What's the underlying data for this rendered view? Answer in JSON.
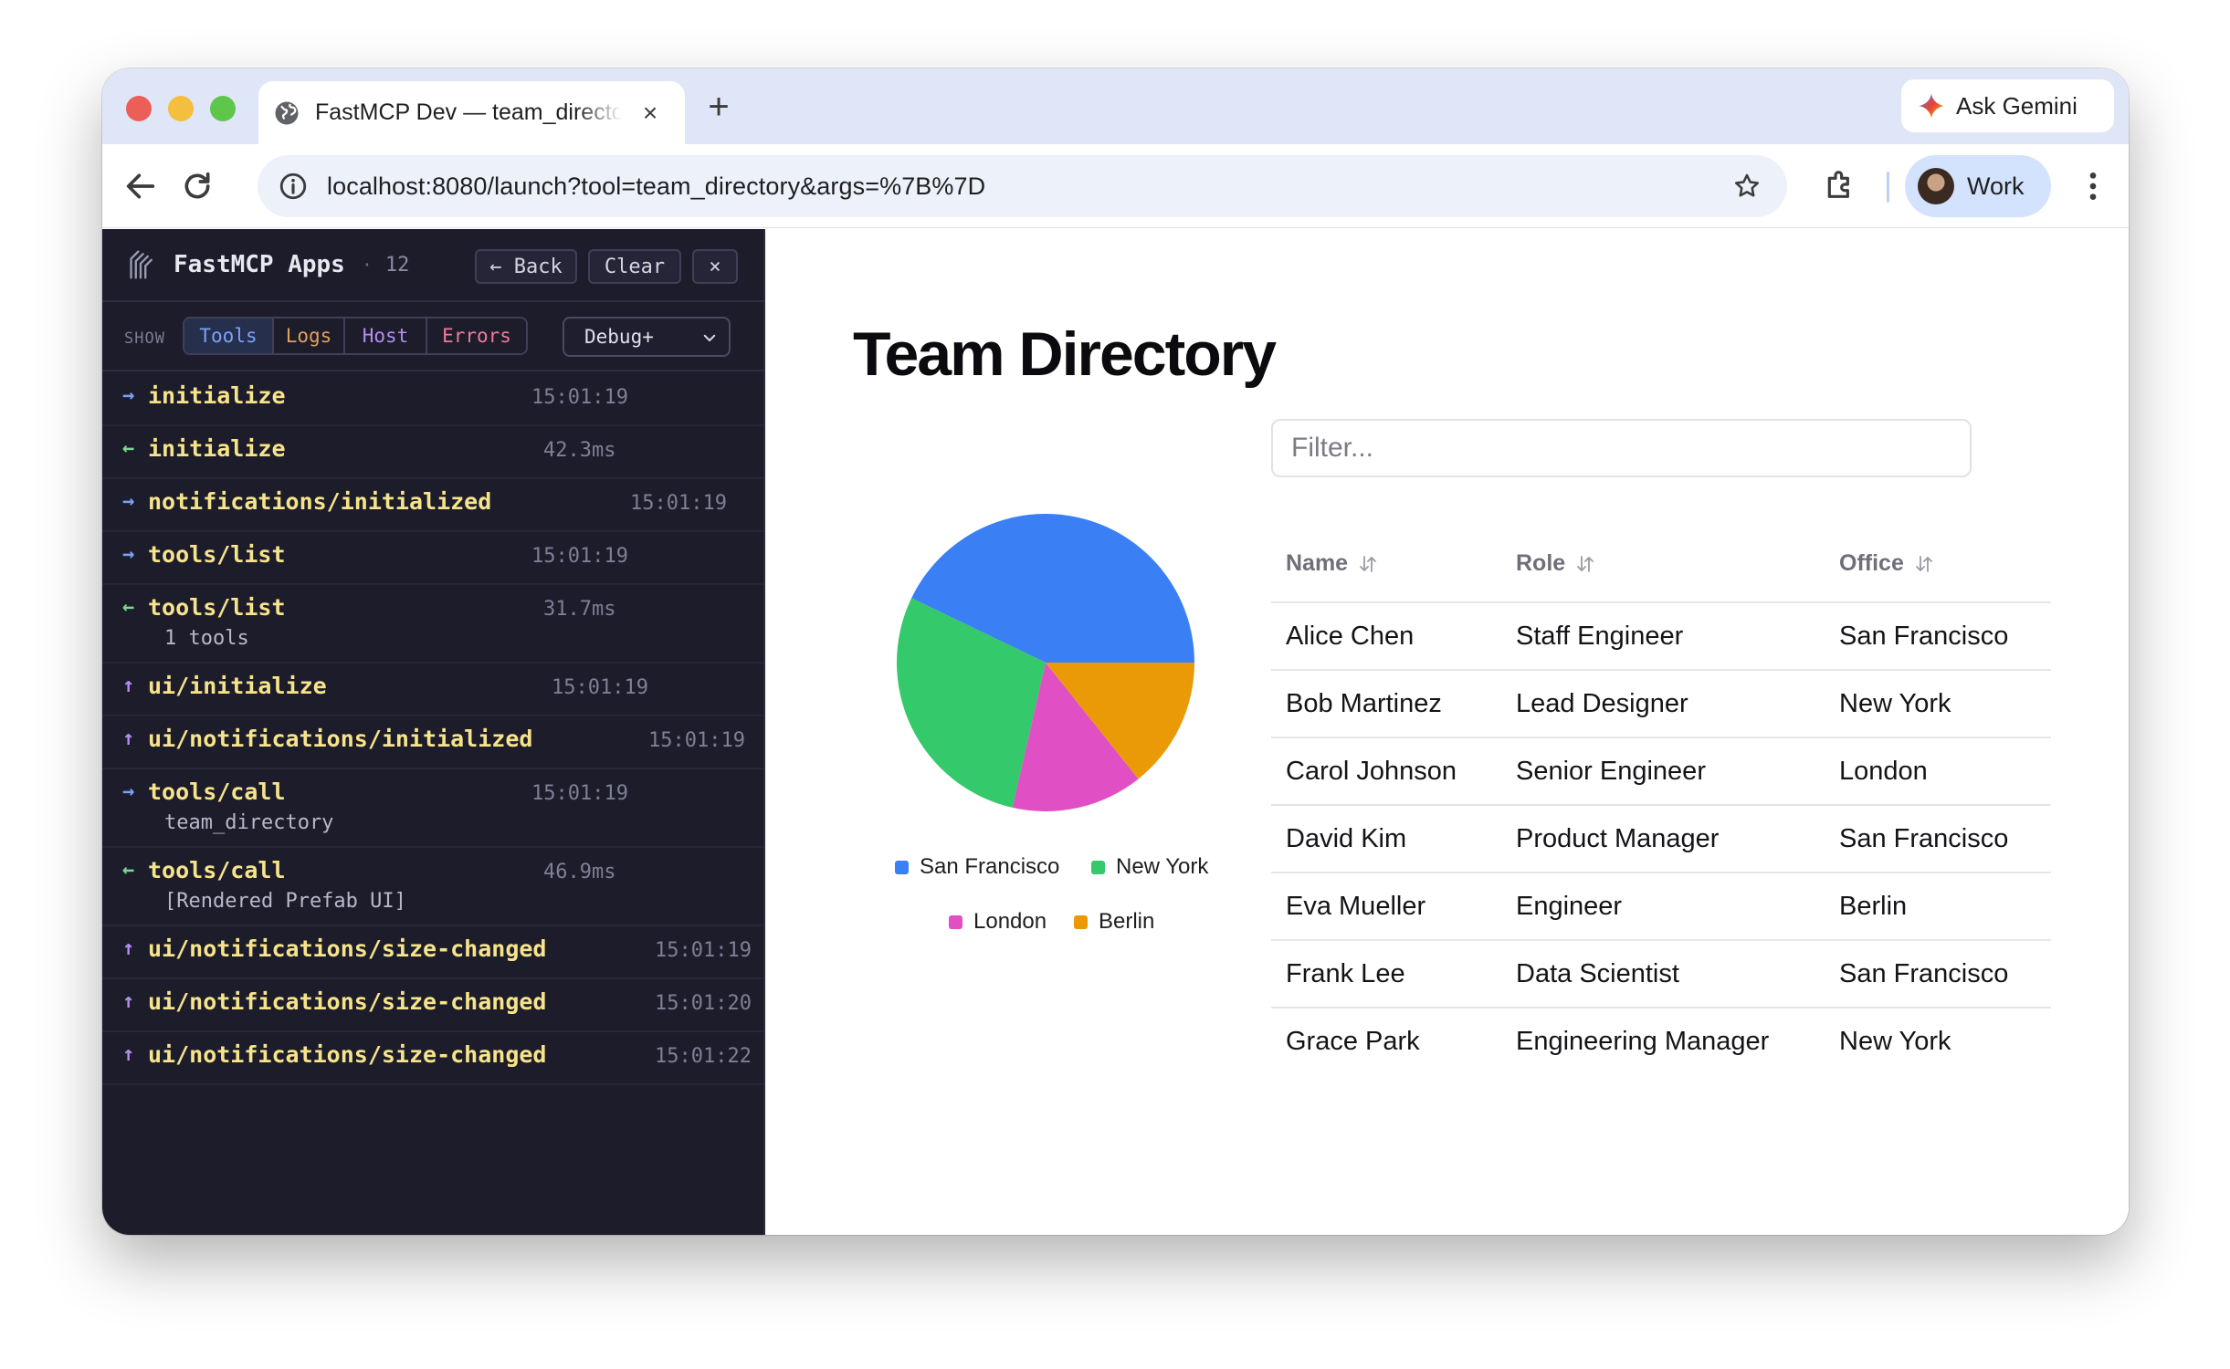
{
  "browser": {
    "tab_title": "FastMCP Dev — team_directory",
    "new_tab_label": "+",
    "close_label": "×",
    "gemini_label": "Ask Gemini",
    "url": "localhost:8080/launch?tool=team_directory&args=%7B%7D",
    "profile_label": "Work"
  },
  "devtools": {
    "title": "FastMCP Apps",
    "separator": "·",
    "count": "12",
    "back_label": "← Back",
    "clear_label": "Clear",
    "close_label": "×",
    "show_label": "SHOW",
    "filters": [
      {
        "label": "Tools",
        "color": "#7aa2f7"
      },
      {
        "label": "Logs",
        "color": "#e0a060"
      },
      {
        "label": "Host",
        "color": "#b48ef0"
      },
      {
        "label": "Errors",
        "color": "#f07a9a"
      }
    ],
    "level_select": "Debug+",
    "logs": [
      {
        "arrow": "→",
        "arrow_color": "#7aa2f7",
        "name": "initialize",
        "meta": "15:01:19",
        "sub": ""
      },
      {
        "arrow": "←",
        "arrow_color": "#7bd88f",
        "name": "initialize",
        "meta": "42.3ms",
        "sub": ""
      },
      {
        "arrow": "→",
        "arrow_color": "#7aa2f7",
        "name": "notifications/initialized",
        "meta": "15:01:19",
        "sub": ""
      },
      {
        "arrow": "→",
        "arrow_color": "#7aa2f7",
        "name": "tools/list",
        "meta": "15:01:19",
        "sub": ""
      },
      {
        "arrow": "←",
        "arrow_color": "#7bd88f",
        "name": "tools/list",
        "meta": "31.7ms",
        "sub": "1 tools"
      },
      {
        "arrow": "↑",
        "arrow_color": "#b48ef0",
        "name": "ui/initialize",
        "meta": "15:01:19",
        "sub": ""
      },
      {
        "arrow": "↑",
        "arrow_color": "#b48ef0",
        "name": "ui/notifications/initialized",
        "meta": "15:01:19",
        "sub": ""
      },
      {
        "arrow": "→",
        "arrow_color": "#7aa2f7",
        "name": "tools/call",
        "meta": "15:01:19",
        "sub": "team_directory"
      },
      {
        "arrow": "←",
        "arrow_color": "#7bd88f",
        "name": "tools/call",
        "meta": "46.9ms",
        "sub": "[Rendered Prefab UI]"
      },
      {
        "arrow": "↑",
        "arrow_color": "#b48ef0",
        "name": "ui/notifications/size-changed",
        "meta": "15:01:19",
        "sub": ""
      },
      {
        "arrow": "↑",
        "arrow_color": "#b48ef0",
        "name": "ui/notifications/size-changed",
        "meta": "15:01:20",
        "sub": ""
      },
      {
        "arrow": "↑",
        "arrow_color": "#b48ef0",
        "name": "ui/notifications/size-changed",
        "meta": "15:01:22",
        "sub": ""
      }
    ]
  },
  "app": {
    "title": "Team Directory",
    "filter_placeholder": "Filter...",
    "columns": [
      "Name",
      "Role",
      "Office"
    ],
    "rows": [
      [
        "Alice Chen",
        "Staff Engineer",
        "San Francisco"
      ],
      [
        "Bob Martinez",
        "Lead Designer",
        "New York"
      ],
      [
        "Carol Johnson",
        "Senior Engineer",
        "London"
      ],
      [
        "David Kim",
        "Product Manager",
        "San Francisco"
      ],
      [
        "Eva Mueller",
        "Engineer",
        "Berlin"
      ],
      [
        "Frank Lee",
        "Data Scientist",
        "San Francisco"
      ],
      [
        "Grace Park",
        "Engineering Manager",
        "New York"
      ]
    ]
  },
  "chart_data": {
    "type": "pie",
    "categories": [
      "San Francisco",
      "New York",
      "London",
      "Berlin"
    ],
    "values": [
      3,
      2,
      1,
      1
    ],
    "colors": [
      "#3b7ff5",
      "#34c96a",
      "#e04fc4",
      "#eb9a07"
    ],
    "legend": "bottom"
  },
  "icons": {
    "globe": "globe-icon",
    "back": "arrow-left-icon",
    "reload": "reload-icon",
    "info": "info-icon",
    "star": "star-icon",
    "extensions": "puzzle-icon",
    "menu": "kebab-menu-icon",
    "sort": "sort-icon",
    "gemini": "sparkle-icon"
  }
}
